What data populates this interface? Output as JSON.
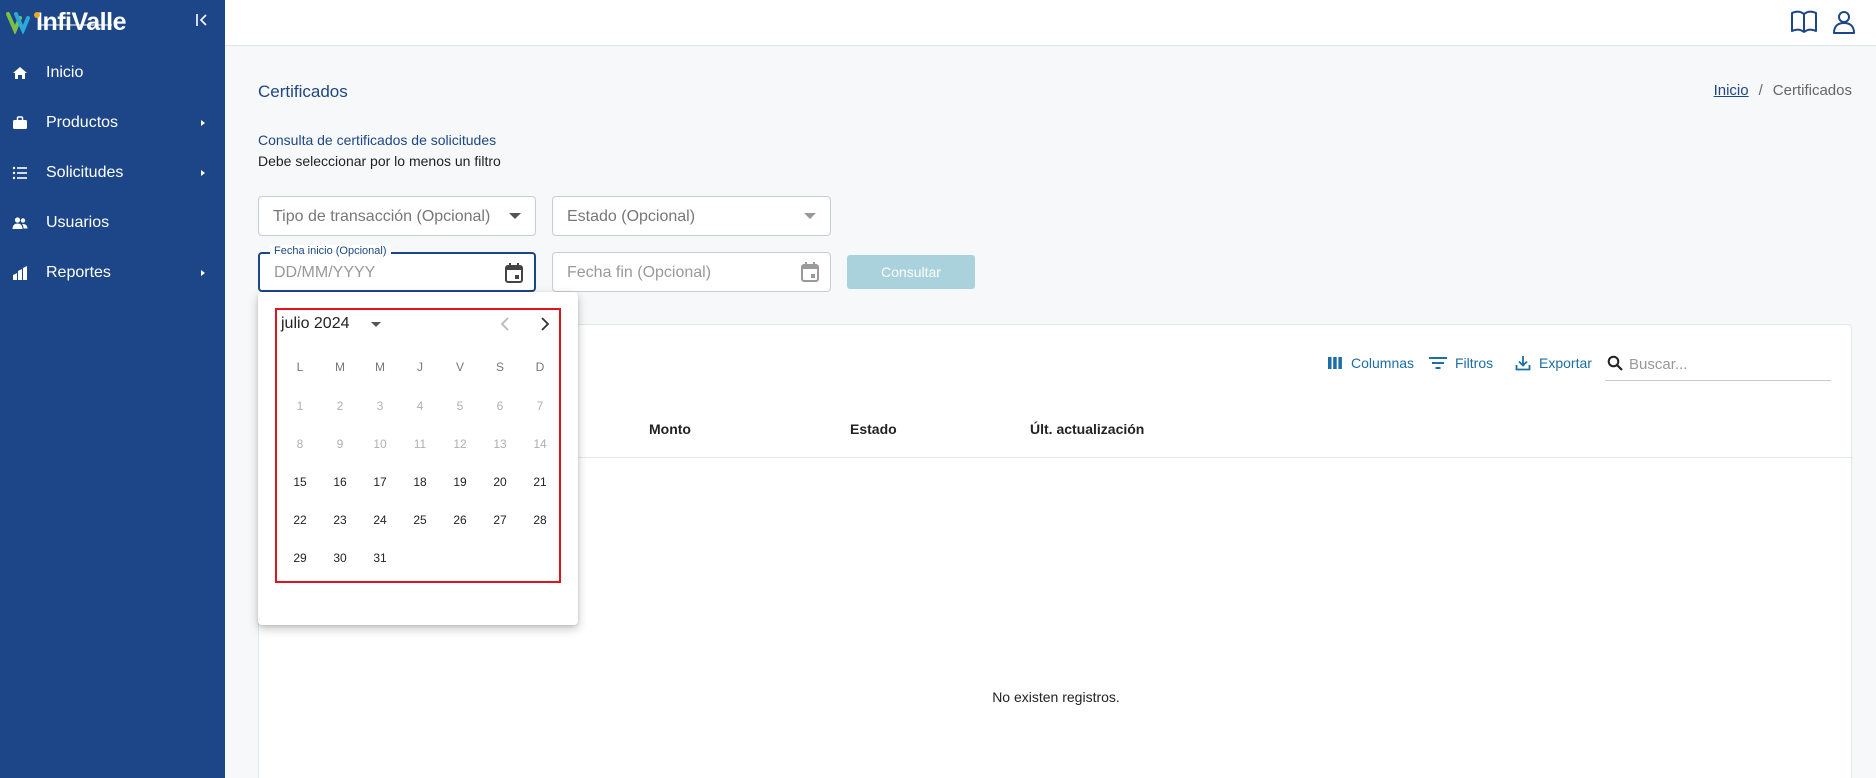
{
  "brand": {
    "name": "InfiValle"
  },
  "sidebar": {
    "items": [
      {
        "label": "Inicio",
        "icon": "home-icon",
        "has_submenu": false
      },
      {
        "label": "Productos",
        "icon": "briefcase-icon",
        "has_submenu": true
      },
      {
        "label": "Solicitudes",
        "icon": "list-icon",
        "has_submenu": true
      },
      {
        "label": "Usuarios",
        "icon": "users-icon",
        "has_submenu": false
      },
      {
        "label": "Reportes",
        "icon": "chart-icon",
        "has_submenu": true
      }
    ]
  },
  "topbar": {
    "icons": [
      "book-icon",
      "user-icon"
    ]
  },
  "page": {
    "title": "Certificados",
    "breadcrumb": {
      "home": "Inicio",
      "separator": "/",
      "current": "Certificados"
    },
    "subtitle": "Consulta de certificados de solicitudes",
    "note": "Debe seleccionar por lo menos un filtro"
  },
  "filters": {
    "tipo_transaccion": "Tipo de transacción (Opcional)",
    "estado": "Estado (Opcional)",
    "fecha_inicio_label": "Fecha inicio (Opcional)",
    "fecha_inicio_placeholder": "DD/MM/YYYY",
    "fecha_fin_placeholder": "Fecha fin (Opcional)",
    "consultar": "Consultar"
  },
  "table": {
    "toolbar": {
      "columnas": "Columnas",
      "filtros": "Filtros",
      "exportar": "Exportar",
      "search_placeholder": "Buscar..."
    },
    "headers": [
      "Monto",
      "Estado",
      "Últ. actualización"
    ],
    "empty_message": "No existen registros."
  },
  "datepicker": {
    "month_label": "julio 2024",
    "weekdays": [
      "L",
      "M",
      "M",
      "J",
      "V",
      "S",
      "D"
    ],
    "weeks": [
      [
        1,
        2,
        3,
        4,
        5,
        6,
        7
      ],
      [
        8,
        9,
        10,
        11,
        12,
        13,
        14
      ],
      [
        15,
        16,
        17,
        18,
        19,
        20,
        21
      ],
      [
        22,
        23,
        24,
        25,
        26,
        27,
        28
      ],
      [
        29,
        30,
        31
      ]
    ],
    "disabled_through": 15
  },
  "colors": {
    "sidebar": "#1c4687",
    "accent": "#1c4687",
    "highlight_frame": "#e0141e",
    "button_disabled": "#a9d2dc"
  }
}
